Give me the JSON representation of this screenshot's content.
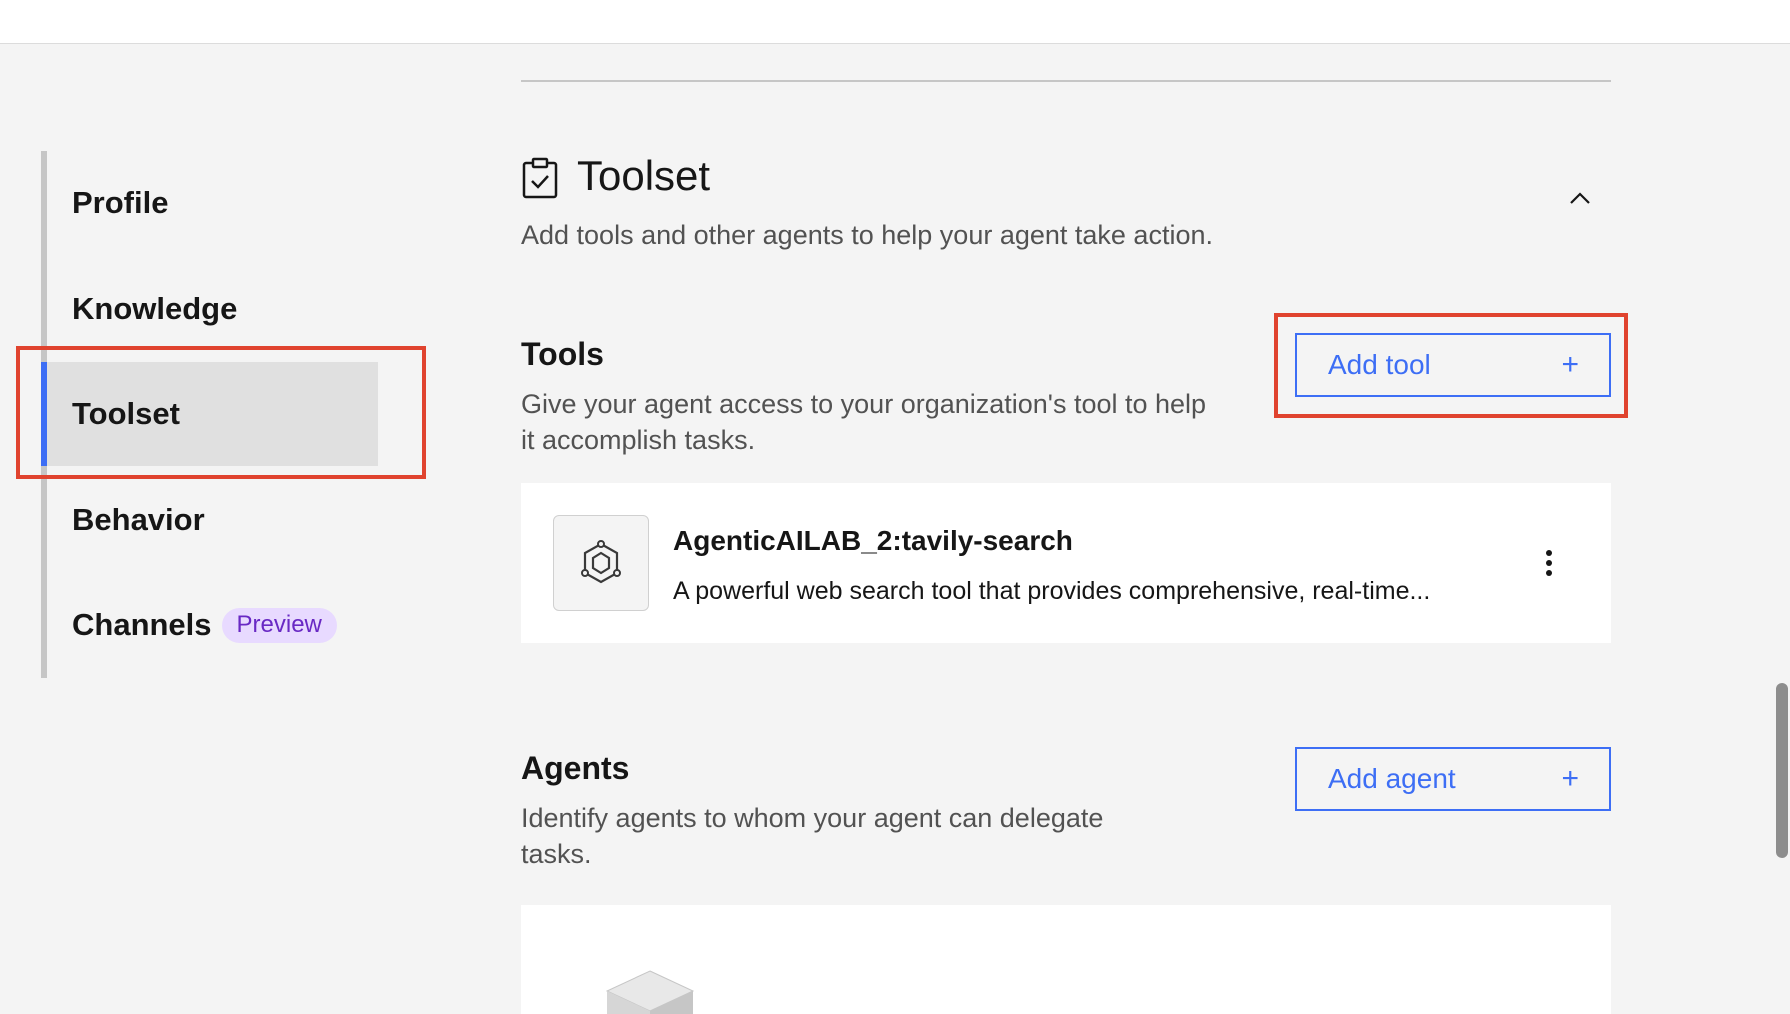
{
  "nav": {
    "items": [
      {
        "label": "Profile"
      },
      {
        "label": "Knowledge"
      },
      {
        "label": "Toolset"
      },
      {
        "label": "Behavior"
      },
      {
        "label": "Channels",
        "badge": "Preview"
      }
    ],
    "active": "Toolset"
  },
  "section": {
    "icon": "clipboard-check-icon",
    "title": "Toolset",
    "description": "Add tools and other agents to help your agent take action."
  },
  "tools": {
    "title": "Tools",
    "description": "Give your agent access to your organization's tool to help it accomplish tasks.",
    "add_label": "Add tool",
    "items": [
      {
        "icon": "hexagon-tool-icon",
        "name": "AgenticAILAB_2:tavily-search",
        "description": "A powerful web search tool that provides comprehensive, real-time..."
      }
    ]
  },
  "agents": {
    "title": "Agents",
    "description": "Identify agents to whom your agent can delegate tasks.",
    "add_label": "Add agent"
  },
  "colors": {
    "accent": "#3d6ef5",
    "highlight": "#e0432e",
    "badge_bg": "#e8daff",
    "badge_text": "#6929c4"
  }
}
